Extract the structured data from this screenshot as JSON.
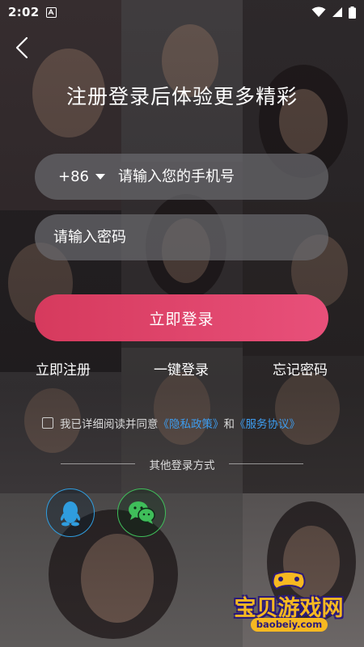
{
  "status_bar": {
    "time": "2:02",
    "left_icon": "a-box-icon",
    "right_icons": [
      "wifi-icon",
      "signal-icon",
      "battery-icon"
    ]
  },
  "nav": {
    "back_icon": "chevron-left-icon"
  },
  "title": "注册登录后体验更多精彩",
  "phone": {
    "country_code": "+86",
    "placeholder": "请输入您的手机号",
    "value": ""
  },
  "password": {
    "placeholder": "请输入密码",
    "value": ""
  },
  "login_button": "立即登录",
  "links": {
    "register": "立即注册",
    "one_click": "一键登录",
    "forgot": "忘记密码"
  },
  "agreement": {
    "checked": false,
    "prefix": "我已详细阅读并同意",
    "privacy": "《隐私政策》",
    "and": "和",
    "service": "《服务协议》"
  },
  "other_login": {
    "title": "其他登录方式",
    "methods": [
      "qq-icon",
      "wechat-icon"
    ]
  },
  "watermark": {
    "name": "宝贝游戏网",
    "url": "baobeiy.com"
  },
  "colors": {
    "login_button": "#d63a5d",
    "qq": "#2f9ddf",
    "wechat": "#3fbe5a",
    "link": "#3d9df0",
    "watermark": "#f6b821"
  }
}
